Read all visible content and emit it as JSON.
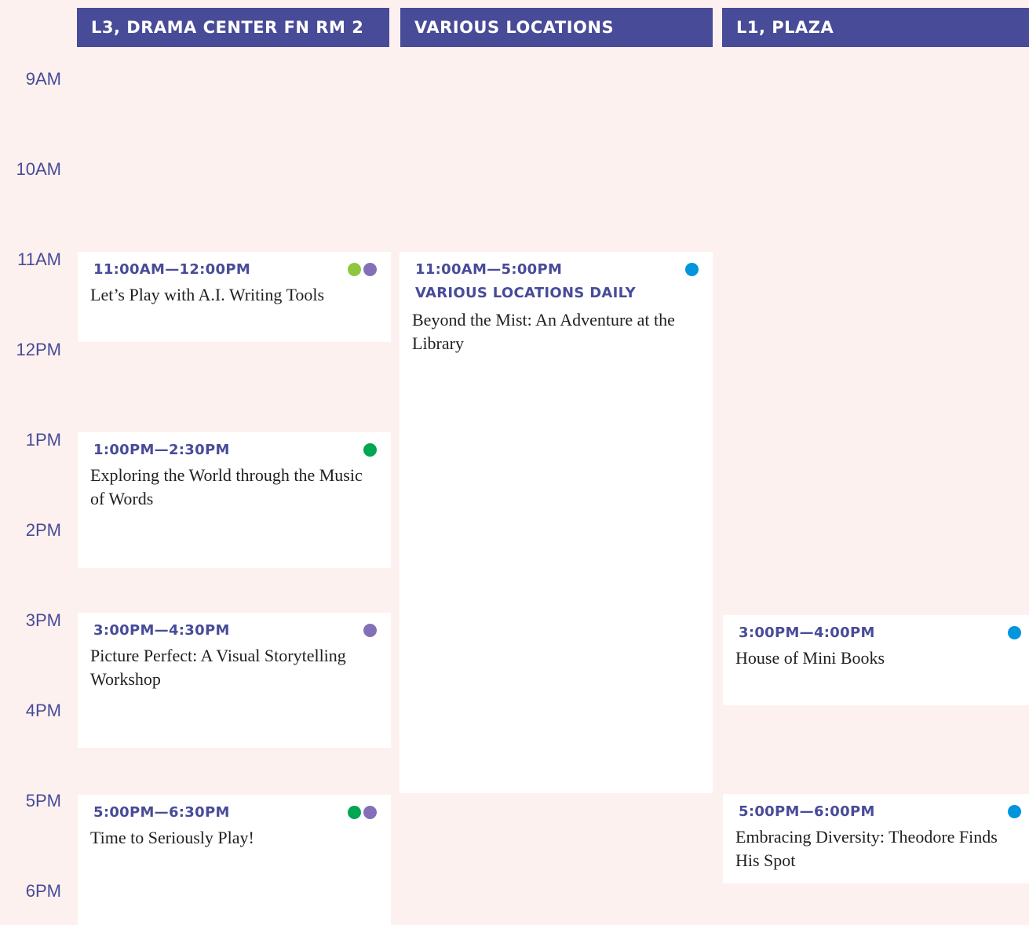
{
  "colors": {
    "header_bg": "#484b98",
    "page_bg": "#fdf1ef",
    "accent_text": "#484b98",
    "card_bg": "#ffffff",
    "lime": "#8dc63f",
    "green": "#00a651",
    "purple": "#8470b8",
    "blue": "#0095dd"
  },
  "columns": [
    {
      "label": "L3, DRAMA CENTER FN RM 2"
    },
    {
      "label": "VARIOUS LOCATIONS"
    },
    {
      "label": "L1, PLAZA"
    }
  ],
  "hours": [
    "9AM",
    "10AM",
    "11AM",
    "12PM",
    "1PM",
    "2PM",
    "3PM",
    "4PM",
    "5PM",
    "6PM"
  ],
  "events": [
    {
      "time": "11:00AM—12:00PM",
      "title": "Let’s Play with A.I. Writing Tools",
      "dots": [
        "lime",
        "purple"
      ]
    },
    {
      "time": "1:00PM—2:30PM",
      "title": "Exploring the World through the Music of Words",
      "dots": [
        "green"
      ]
    },
    {
      "time": "3:00PM—4:30PM",
      "title": "Picture Perfect: A Visual Storytelling Workshop",
      "dots": [
        "purple"
      ]
    },
    {
      "time": "5:00PM—6:30PM",
      "title": "Time to Seriously Play!",
      "dots": [
        "green",
        "purple"
      ]
    },
    {
      "time": "11:00AM—5:00PM",
      "subtitle": "VARIOUS LOCATIONS DAILY",
      "title": "Beyond the Mist: An Adventure at the Library",
      "dots": [
        "blue"
      ]
    },
    {
      "time": "3:00PM—4:00PM",
      "title": "House of Mini Books",
      "dots": [
        "blue"
      ]
    },
    {
      "time": "5:00PM—6:00PM",
      "title": "Embracing Diversity: Theodore Finds His Spot",
      "dots": [
        "blue"
      ]
    }
  ]
}
